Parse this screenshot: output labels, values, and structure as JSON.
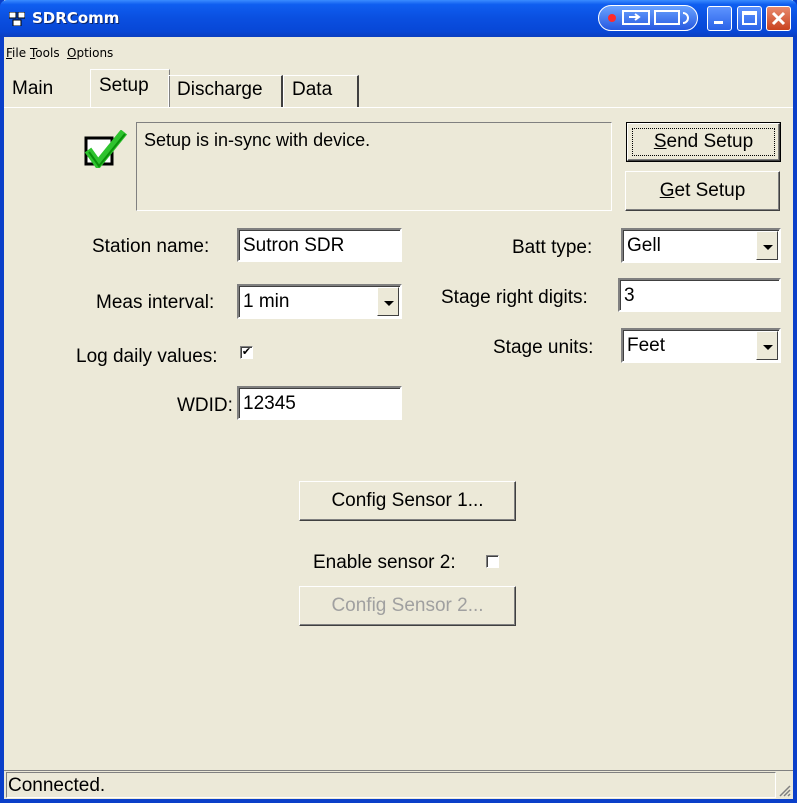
{
  "window": {
    "title": "SDRComm"
  },
  "menu": [
    {
      "label": "File",
      "accel": "F",
      "rest": "ile"
    },
    {
      "label": "Tools",
      "accel": "T",
      "rest": "ools"
    },
    {
      "label": "Options",
      "accel": "O",
      "rest": "ptions"
    }
  ],
  "tabs": [
    "Main",
    "Setup",
    "Discharge",
    "Data"
  ],
  "active_tab": "Setup",
  "sync": {
    "message": "Setup is in-sync with device.",
    "icon": "green-check-icon"
  },
  "buttons": {
    "send_setup": {
      "accel": "S",
      "rest": "end Setup"
    },
    "get_setup": {
      "accel": "G",
      "rest": "et Setup"
    },
    "config_sensor1": "Config Sensor 1...",
    "config_sensor2": "Config Sensor 2..."
  },
  "form": {
    "station_name_label": "Station name:",
    "station_name_value": "Sutron SDR",
    "meas_interval_label": "Meas interval:",
    "meas_interval_value": "1 min",
    "log_daily_label": "Log daily values:",
    "log_daily_checked": "✔",
    "wdid_label": "WDID:",
    "wdid_value": "12345",
    "batt_type_label": "Batt type:",
    "batt_type_value": "Gell",
    "stage_digits_label": "Stage right digits:",
    "stage_digits_value": "3",
    "stage_units_label": "Stage units:",
    "stage_units_value": "Feet",
    "enable_sensor2_label": "Enable sensor 2:"
  },
  "status": {
    "text": "Connected."
  },
  "colors": {
    "titlebar": "#0a4fe0",
    "face": "#ece9d8",
    "check": "#2ec32e"
  }
}
